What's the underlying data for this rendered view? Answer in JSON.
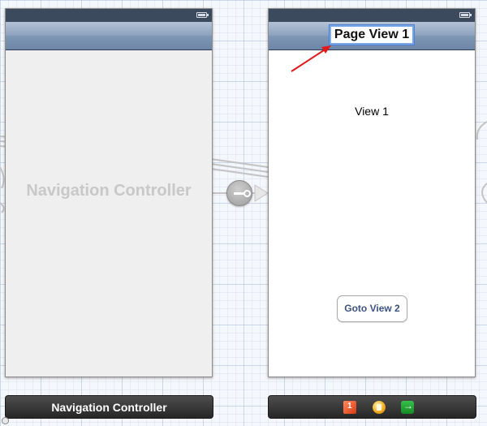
{
  "canvas": {
    "grid": "on"
  },
  "navigation_controller_scene": {
    "placeholder_label": "Navigation Controller",
    "dock_title": "Navigation Controller"
  },
  "page_view_scene": {
    "nav_title": "Page View 1",
    "view_label": "View 1",
    "button_label": "Goto View 2",
    "dock_icons": [
      "view-controller-cube-icon",
      "first-responder-icon",
      "exit-icon"
    ]
  },
  "annotation": {
    "arrow_color": "#e01a1a"
  },
  "colors": {
    "nav_bar": "#7f96b5",
    "status_bar": "#3c4a5e",
    "button_text": "#3b5382"
  }
}
